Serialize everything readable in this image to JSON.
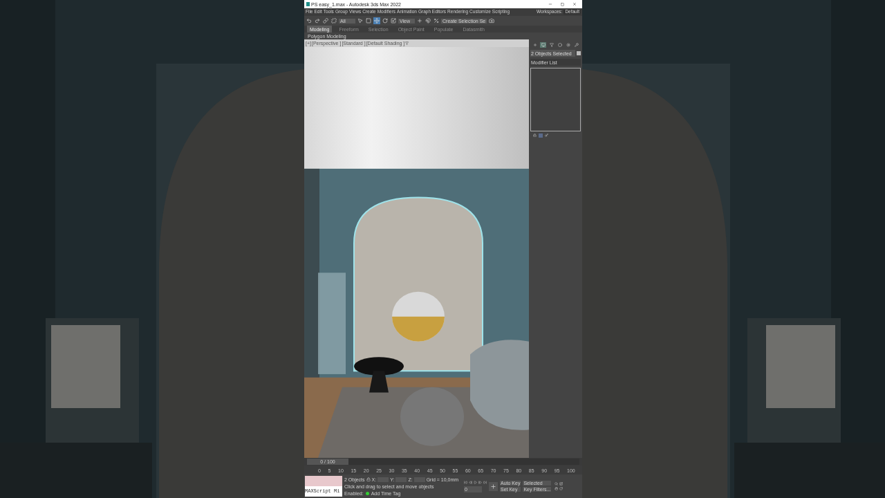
{
  "window": {
    "title": "PS easy_1.max - Autodesk 3ds Max 2022"
  },
  "menu": [
    "File",
    "Edit",
    "Tools",
    "Group",
    "Views",
    "Create",
    "Modifiers",
    "Animation",
    "Graph Editors",
    "Rendering",
    "Customize",
    "Scripting"
  ],
  "workspaces": {
    "label": "Workspaces:",
    "value": "Default"
  },
  "toolbar": {
    "filter": "All",
    "coordinate": "View",
    "selection_set": "Create Selection Se"
  },
  "ribbon_tabs": [
    {
      "label": "Modeling",
      "selected": true
    },
    {
      "label": "Freeform",
      "selected": false
    },
    {
      "label": "Selection",
      "selected": false
    },
    {
      "label": "Object Paint",
      "selected": false
    },
    {
      "label": "Populate",
      "selected": false
    },
    {
      "label": "Datasmith",
      "selected": false
    }
  ],
  "ribbon_panel": "Polygon Modeling",
  "viewport": {
    "labels": [
      "[+]",
      "[Perspective ]",
      "[Standard ]",
      "[Default Shading ]"
    ],
    "kind": "picture"
  },
  "command_panel": {
    "tabs": [
      {
        "selected": false
      },
      {
        "selected": true
      },
      {
        "selected": false
      },
      {
        "selected": false
      },
      {
        "selected": false
      },
      {
        "selected": false
      }
    ],
    "selection_name": "2 Objects Selected",
    "modifier_list": "Modifier List"
  },
  "timeline": {
    "frame": "0 / 100",
    "level": 0,
    "ticks": [
      "0",
      "5",
      "10",
      "15",
      "20",
      "25",
      "30",
      "35",
      "40",
      "45",
      "50",
      "55",
      "60",
      "65",
      "70",
      "75",
      "80",
      "85",
      "90",
      "95",
      "100"
    ]
  },
  "status": {
    "maxscript": "MAXScript Mi",
    "objects": "2 Objects",
    "x": "X:",
    "y": "Y:",
    "z": "Z:",
    "grid": "Grid = 10,0mm",
    "prompt": "Click and drag to select and move objects",
    "enabled": "Enabled:",
    "time_tag": "Add Time Tag",
    "current_frame": "0",
    "auto_key": "Auto Key",
    "set_key": "Set Key",
    "key_mode": "Selected",
    "key_filters": "Key Filters..."
  }
}
